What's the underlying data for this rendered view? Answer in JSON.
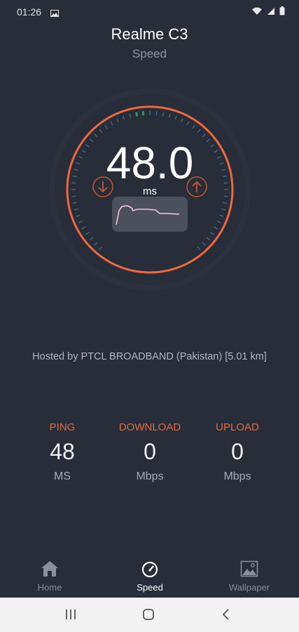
{
  "status_bar": {
    "time": "01:26"
  },
  "header": {
    "title": "Realme C3",
    "subtitle": "Speed"
  },
  "gauge": {
    "value": "48.0",
    "unit": "ms",
    "ring_color": "#f0683c",
    "tick_color": "#3c6e8a",
    "needle_color": "#2f9a6a"
  },
  "server": {
    "text": "Hosted by PTCL BROADBAND (Pakistan) [5.01 km]"
  },
  "stats": {
    "ping": {
      "label": "PING",
      "value": "48",
      "unit": "MS"
    },
    "download": {
      "label": "DOWNLOAD",
      "value": "0",
      "unit": "Mbps"
    },
    "upload": {
      "label": "UPLOAD",
      "value": "0",
      "unit": "Mbps"
    }
  },
  "bottom_nav": {
    "items": [
      {
        "label": "Home",
        "icon": "home-icon"
      },
      {
        "label": "Speed",
        "icon": "speedometer-icon",
        "active": true
      },
      {
        "label": "Wallpaper",
        "icon": "image-icon"
      }
    ]
  },
  "accent_color": "#e8693c",
  "background_color": "#272d39"
}
